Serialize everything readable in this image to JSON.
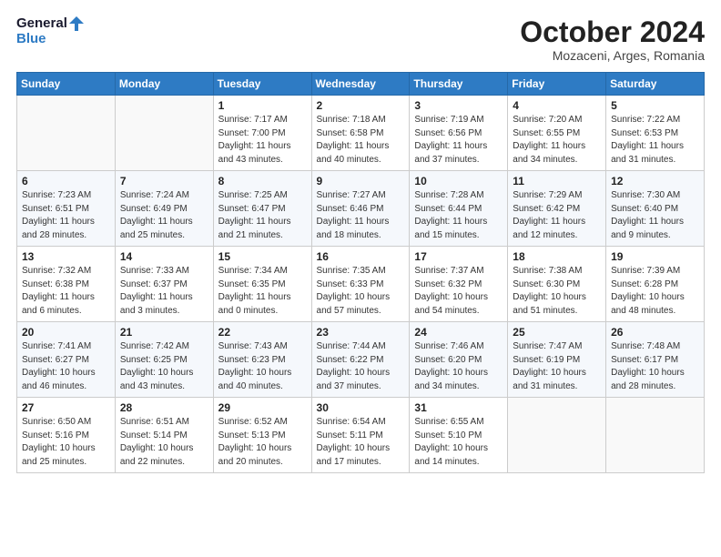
{
  "header": {
    "logo_line1": "General",
    "logo_line2": "Blue",
    "month_title": "October 2024",
    "location": "Mozaceni, Arges, Romania"
  },
  "weekdays": [
    "Sunday",
    "Monday",
    "Tuesday",
    "Wednesday",
    "Thursday",
    "Friday",
    "Saturday"
  ],
  "weeks": [
    [
      {
        "day": "",
        "info": ""
      },
      {
        "day": "",
        "info": ""
      },
      {
        "day": "1",
        "info": "Sunrise: 7:17 AM\nSunset: 7:00 PM\nDaylight: 11 hours and 43 minutes."
      },
      {
        "day": "2",
        "info": "Sunrise: 7:18 AM\nSunset: 6:58 PM\nDaylight: 11 hours and 40 minutes."
      },
      {
        "day": "3",
        "info": "Sunrise: 7:19 AM\nSunset: 6:56 PM\nDaylight: 11 hours and 37 minutes."
      },
      {
        "day": "4",
        "info": "Sunrise: 7:20 AM\nSunset: 6:55 PM\nDaylight: 11 hours and 34 minutes."
      },
      {
        "day": "5",
        "info": "Sunrise: 7:22 AM\nSunset: 6:53 PM\nDaylight: 11 hours and 31 minutes."
      }
    ],
    [
      {
        "day": "6",
        "info": "Sunrise: 7:23 AM\nSunset: 6:51 PM\nDaylight: 11 hours and 28 minutes."
      },
      {
        "day": "7",
        "info": "Sunrise: 7:24 AM\nSunset: 6:49 PM\nDaylight: 11 hours and 25 minutes."
      },
      {
        "day": "8",
        "info": "Sunrise: 7:25 AM\nSunset: 6:47 PM\nDaylight: 11 hours and 21 minutes."
      },
      {
        "day": "9",
        "info": "Sunrise: 7:27 AM\nSunset: 6:46 PM\nDaylight: 11 hours and 18 minutes."
      },
      {
        "day": "10",
        "info": "Sunrise: 7:28 AM\nSunset: 6:44 PM\nDaylight: 11 hours and 15 minutes."
      },
      {
        "day": "11",
        "info": "Sunrise: 7:29 AM\nSunset: 6:42 PM\nDaylight: 11 hours and 12 minutes."
      },
      {
        "day": "12",
        "info": "Sunrise: 7:30 AM\nSunset: 6:40 PM\nDaylight: 11 hours and 9 minutes."
      }
    ],
    [
      {
        "day": "13",
        "info": "Sunrise: 7:32 AM\nSunset: 6:38 PM\nDaylight: 11 hours and 6 minutes."
      },
      {
        "day": "14",
        "info": "Sunrise: 7:33 AM\nSunset: 6:37 PM\nDaylight: 11 hours and 3 minutes."
      },
      {
        "day": "15",
        "info": "Sunrise: 7:34 AM\nSunset: 6:35 PM\nDaylight: 11 hours and 0 minutes."
      },
      {
        "day": "16",
        "info": "Sunrise: 7:35 AM\nSunset: 6:33 PM\nDaylight: 10 hours and 57 minutes."
      },
      {
        "day": "17",
        "info": "Sunrise: 7:37 AM\nSunset: 6:32 PM\nDaylight: 10 hours and 54 minutes."
      },
      {
        "day": "18",
        "info": "Sunrise: 7:38 AM\nSunset: 6:30 PM\nDaylight: 10 hours and 51 minutes."
      },
      {
        "day": "19",
        "info": "Sunrise: 7:39 AM\nSunset: 6:28 PM\nDaylight: 10 hours and 48 minutes."
      }
    ],
    [
      {
        "day": "20",
        "info": "Sunrise: 7:41 AM\nSunset: 6:27 PM\nDaylight: 10 hours and 46 minutes."
      },
      {
        "day": "21",
        "info": "Sunrise: 7:42 AM\nSunset: 6:25 PM\nDaylight: 10 hours and 43 minutes."
      },
      {
        "day": "22",
        "info": "Sunrise: 7:43 AM\nSunset: 6:23 PM\nDaylight: 10 hours and 40 minutes."
      },
      {
        "day": "23",
        "info": "Sunrise: 7:44 AM\nSunset: 6:22 PM\nDaylight: 10 hours and 37 minutes."
      },
      {
        "day": "24",
        "info": "Sunrise: 7:46 AM\nSunset: 6:20 PM\nDaylight: 10 hours and 34 minutes."
      },
      {
        "day": "25",
        "info": "Sunrise: 7:47 AM\nSunset: 6:19 PM\nDaylight: 10 hours and 31 minutes."
      },
      {
        "day": "26",
        "info": "Sunrise: 7:48 AM\nSunset: 6:17 PM\nDaylight: 10 hours and 28 minutes."
      }
    ],
    [
      {
        "day": "27",
        "info": "Sunrise: 6:50 AM\nSunset: 5:16 PM\nDaylight: 10 hours and 25 minutes."
      },
      {
        "day": "28",
        "info": "Sunrise: 6:51 AM\nSunset: 5:14 PM\nDaylight: 10 hours and 22 minutes."
      },
      {
        "day": "29",
        "info": "Sunrise: 6:52 AM\nSunset: 5:13 PM\nDaylight: 10 hours and 20 minutes."
      },
      {
        "day": "30",
        "info": "Sunrise: 6:54 AM\nSunset: 5:11 PM\nDaylight: 10 hours and 17 minutes."
      },
      {
        "day": "31",
        "info": "Sunrise: 6:55 AM\nSunset: 5:10 PM\nDaylight: 10 hours and 14 minutes."
      },
      {
        "day": "",
        "info": ""
      },
      {
        "day": "",
        "info": ""
      }
    ]
  ]
}
